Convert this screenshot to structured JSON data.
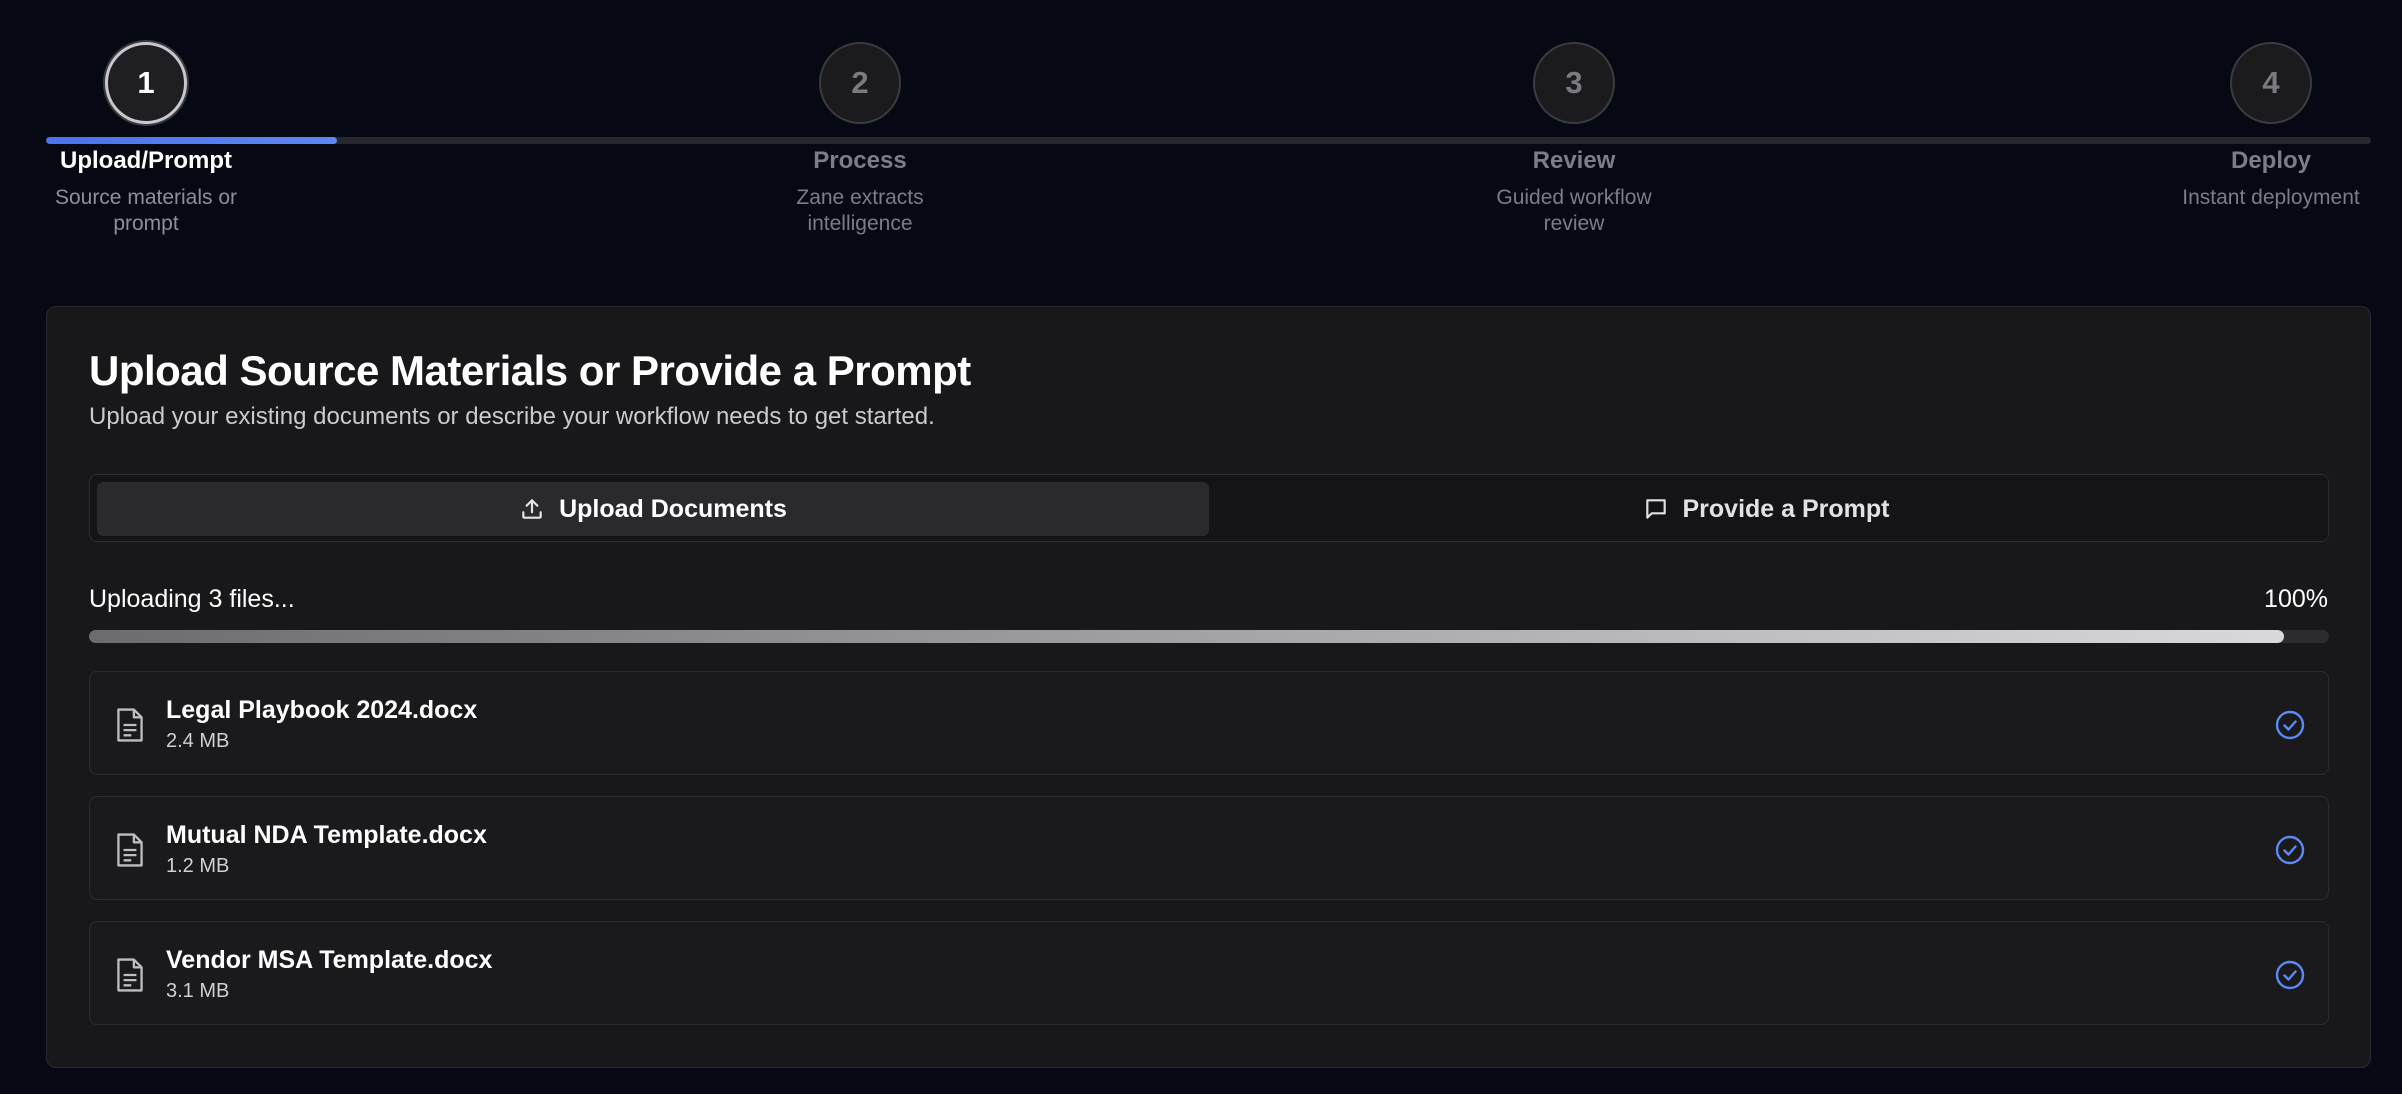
{
  "steps": [
    {
      "number": "1",
      "label": "Upload/Prompt",
      "desc_line1": "Source materials or",
      "desc_line2": "prompt",
      "active": true
    },
    {
      "number": "2",
      "label": "Process",
      "desc_line1": "Zane extracts",
      "desc_line2": "intelligence",
      "active": false
    },
    {
      "number": "3",
      "label": "Review",
      "desc_line1": "Guided workflow",
      "desc_line2": "review",
      "active": false
    },
    {
      "number": "4",
      "label": "Deploy",
      "desc_line1": "Instant deployment",
      "desc_line2": "",
      "active": false
    }
  ],
  "stepper_progress": 0.125,
  "card": {
    "title": "Upload Source Materials or Provide a Prompt",
    "subtitle": "Upload your existing documents or describe your workflow needs to get started."
  },
  "tabs": {
    "upload_label": "Upload Documents",
    "prompt_label": "Provide a Prompt",
    "upload_icon": "upload-icon",
    "prompt_icon": "message-icon"
  },
  "upload": {
    "status": "Uploading 3 files...",
    "percent_label": "100%",
    "progress": 0.98
  },
  "files": [
    {
      "name": "Legal Playbook 2024.docx",
      "size": "2.4 MB",
      "status_icon": "check-circle-icon"
    },
    {
      "name": "Mutual NDA Template.docx",
      "size": "1.2 MB",
      "status_icon": "check-circle-icon"
    },
    {
      "name": "Vendor MSA Template.docx",
      "size": "3.1 MB",
      "status_icon": "check-circle-icon"
    }
  ],
  "colors": {
    "background": "#060814",
    "accent": "#4b72f0",
    "card": "#18181b",
    "check": "#5b8af5"
  }
}
